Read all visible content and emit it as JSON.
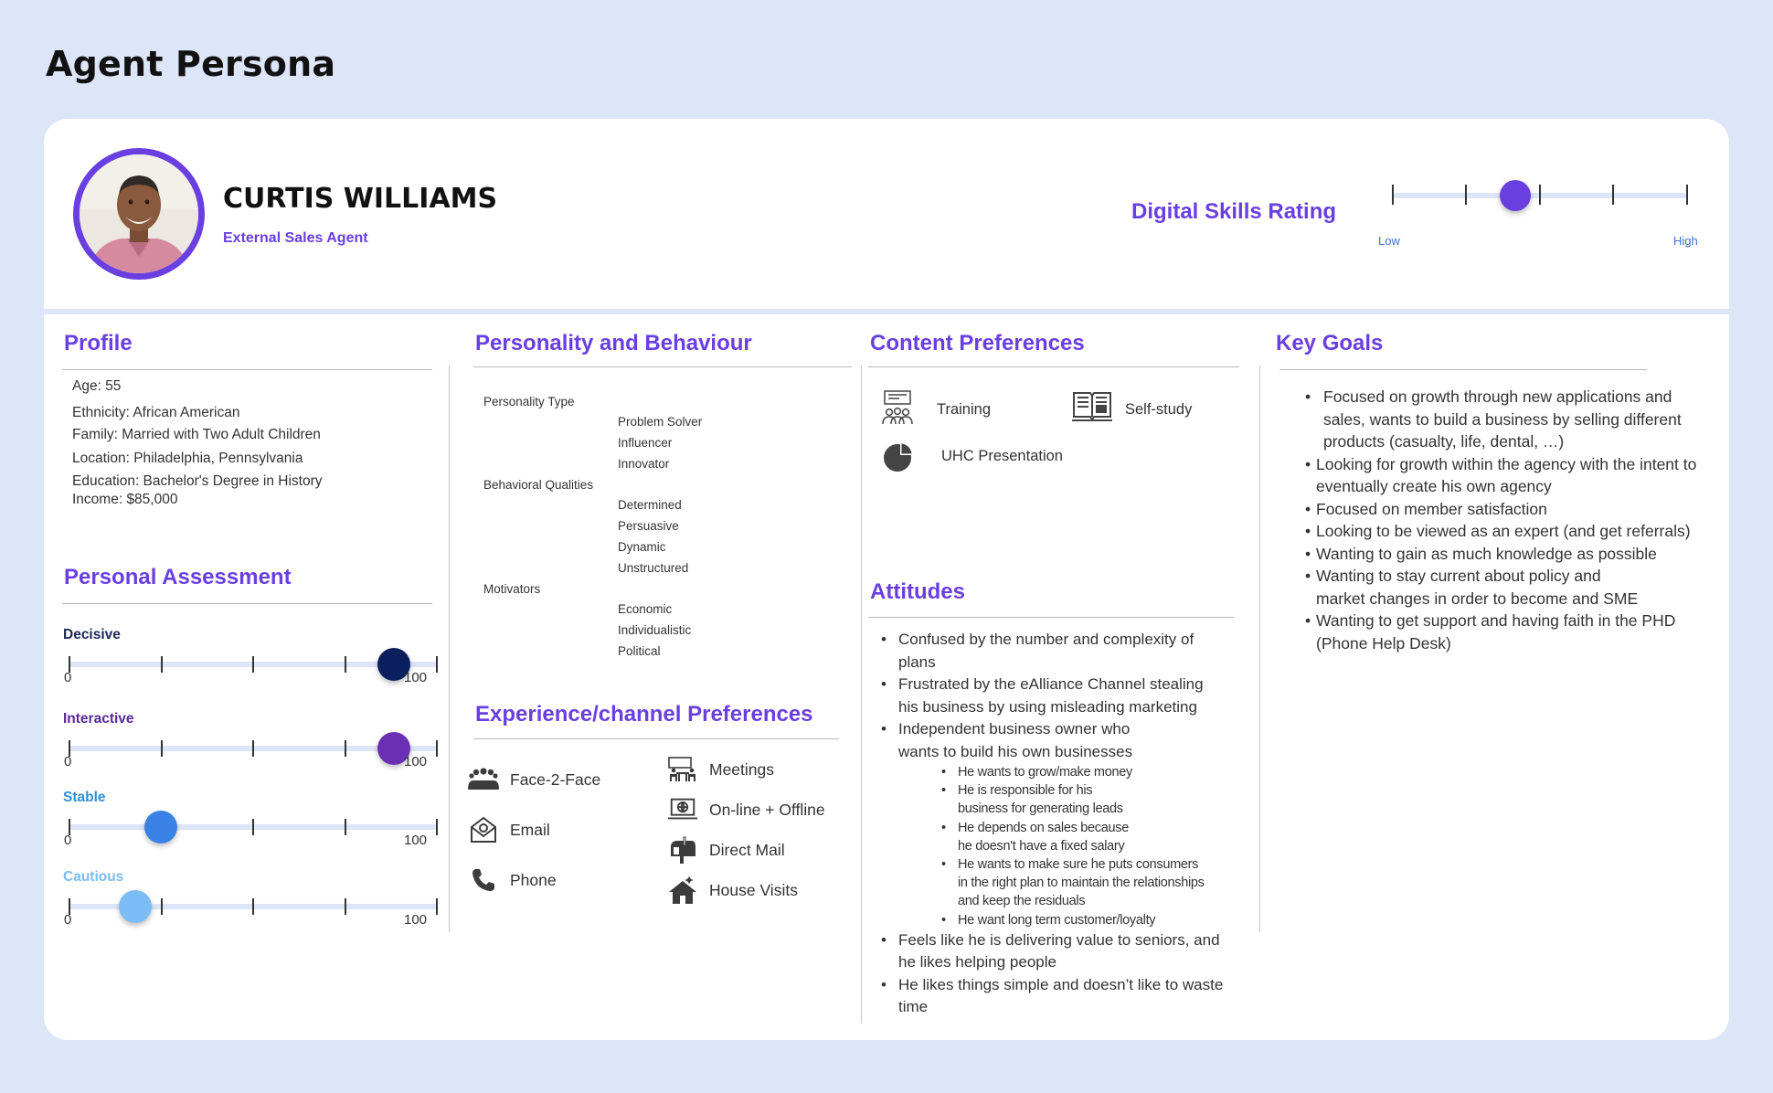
{
  "page": {
    "title": "Agent Persona"
  },
  "person": {
    "name": "CURTIS WILLIAMS",
    "role": "External Sales Agent",
    "avatar_icon": "person-photo"
  },
  "digital_skills": {
    "title": "Digital Skills Rating",
    "low_label": "Low",
    "high_label": "High",
    "value_fraction": 0.42,
    "knob_color": "#6a3fe0"
  },
  "profile": {
    "title": "Profile",
    "lines": [
      "Age: 55",
      "Ethnicity:  African American",
      "Family: Married with Two Adult Children",
      "Location: Philadelphia, Pennsylvania",
      "Education: Bachelor's Degree in History",
      "Income: $85,000"
    ]
  },
  "assessment": {
    "title": "Personal Assessment",
    "min_label": "0",
    "max_label": "100",
    "items": [
      {
        "label": "Decisive",
        "value": 88,
        "label_color": "#1a2a55",
        "knob_color": "#0b1f5e"
      },
      {
        "label": "Interactive",
        "value": 88,
        "label_color": "#5a2a9a",
        "knob_color": "#6a2fb3"
      },
      {
        "label": "Stable",
        "value": 25,
        "label_color": "#2d8fd8",
        "knob_color": "#3a82e6"
      },
      {
        "label": "Cautious",
        "value": 18,
        "label_color": "#7cbcf0",
        "knob_color": "#7dbdf7"
      }
    ]
  },
  "personality": {
    "title": "Personality and Behaviour",
    "groups": [
      {
        "label": "Personality Type",
        "items": [
          "Problem Solver",
          "Influencer",
          "Innovator"
        ]
      },
      {
        "label": "Behavioral Qualities",
        "items": [
          "Determined",
          "Persuasive",
          "Dynamic",
          "Unstructured"
        ]
      },
      {
        "label": "Motivators",
        "items": [
          "Economic",
          "Individualistic",
          "Political"
        ]
      }
    ]
  },
  "channels": {
    "title": "Experience/channel Preferences",
    "left": [
      {
        "label": "Face-2-Face",
        "icon": "group-icon"
      },
      {
        "label": "Email",
        "icon": "email-icon"
      },
      {
        "label": "Phone",
        "icon": "phone-icon"
      }
    ],
    "right": [
      {
        "label": "Meetings",
        "icon": "meeting-icon"
      },
      {
        "label": "On-line + Offline",
        "icon": "laptop-globe-icon"
      },
      {
        "label": "Direct Mail",
        "icon": "mailbox-icon"
      },
      {
        "label": "House Visits",
        "icon": "house-icon"
      }
    ]
  },
  "content": {
    "title": "Content Preferences",
    "items": [
      {
        "label": "Training",
        "icon": "training-icon"
      },
      {
        "label": "Self-study",
        "icon": "book-icon"
      },
      {
        "label": "UHC Presentation",
        "icon": "pie-chart-icon"
      }
    ]
  },
  "attitudes": {
    "title": "Attitudes",
    "items": [
      [
        "Confused by the number and complexity of",
        "plans"
      ],
      [
        "Frustrated by the eAlliance Channel stealing",
        "his business by using misleading marketing"
      ],
      [
        "Independent business owner who",
        "wants to  build his own businesses"
      ]
    ],
    "sub_items": [
      [
        "He wants to grow/make money"
      ],
      [
        "He is responsible for his",
        "business for generating leads"
      ],
      [
        "He depends on sales because",
        "he doesn't have a fixed salary"
      ],
      [
        "He wants to make sure he puts consumers",
        "in the right plan to maintain the relationships",
        "and keep the residuals"
      ],
      [
        "He want long term customer/loyalty"
      ]
    ],
    "items_after": [
      [
        "Feels like he is delivering value to seniors, and",
        "he likes helping people"
      ],
      [
        "He likes things simple and doesn’t like to waste",
        "time"
      ]
    ]
  },
  "goals": {
    "title": "Key Goals",
    "items": [
      [
        "Focused on growth through new applications and",
        "sales, wants to build a business by selling different",
        "products (casualty, life, dental, …)"
      ],
      [
        "Looking for growth within the agency with the intent to",
        "eventually create his own agency"
      ],
      [
        "Focused on member satisfaction"
      ],
      [
        "Looking to be viewed as an expert (and get referrals)"
      ],
      [
        "Wanting to gain as much knowledge as possible"
      ],
      [
        "Wanting to stay current about policy and",
        "market changes in order to become  and SME"
      ],
      [
        "Wanting to get support and having faith in the PHD",
        "(Phone Help Desk)"
      ]
    ]
  }
}
